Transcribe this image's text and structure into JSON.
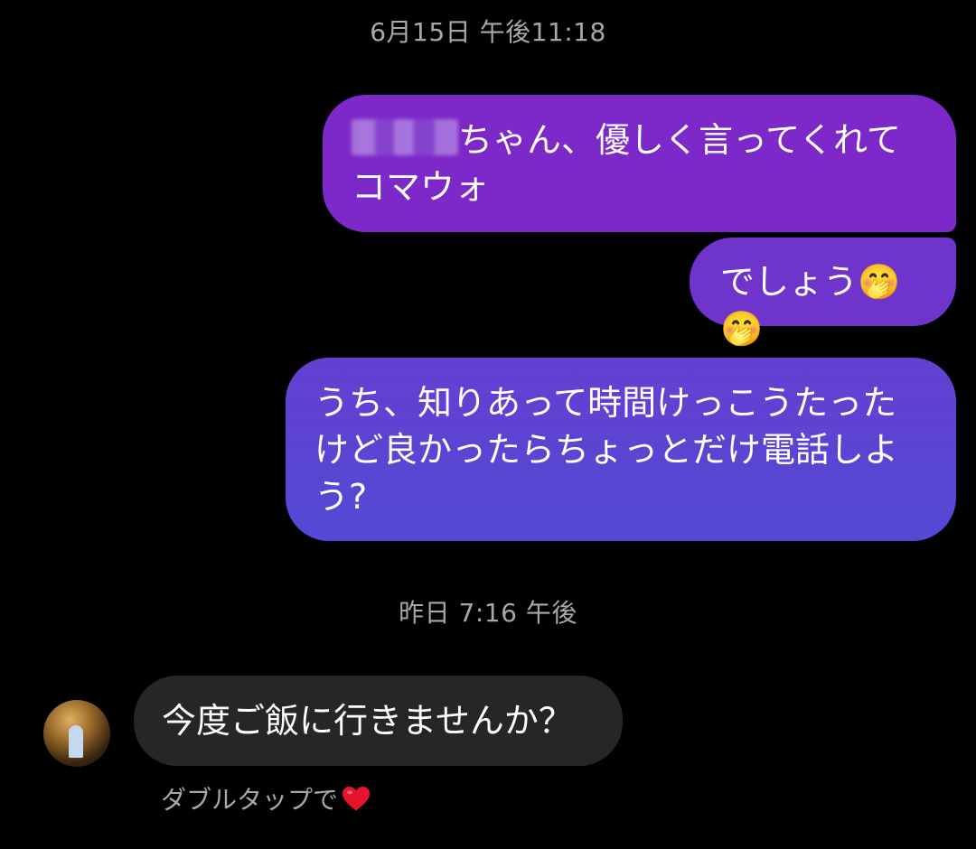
{
  "conversation": {
    "timestamp_1": "6月15日 午後11:18",
    "timestamp_2": "昨日 7:16 午後",
    "outgoing": [
      {
        "line1_after_blur": "ちゃん、優しく言ってくれて",
        "line2": "コマウォ"
      },
      {
        "text": "でしょう🤭🤭"
      },
      {
        "text": "うち、知りあって時間けっこうたったけど良かったらちょっとだけ電話しよう?"
      }
    ],
    "incoming": [
      {
        "text": "今度ご飯に行きませんか？"
      }
    ],
    "double_tap_hint": "ダブルタップで",
    "icons": {
      "reaction_heart": "heart-icon",
      "avatar": "avatar"
    }
  },
  "colors": {
    "background": "#000000",
    "outgoing_top": "#7d28c8",
    "outgoing_bottom": "#5349d4",
    "incoming_bubble": "#262626",
    "meta_text": "#a8a8a8",
    "heart": "#e8142e"
  }
}
